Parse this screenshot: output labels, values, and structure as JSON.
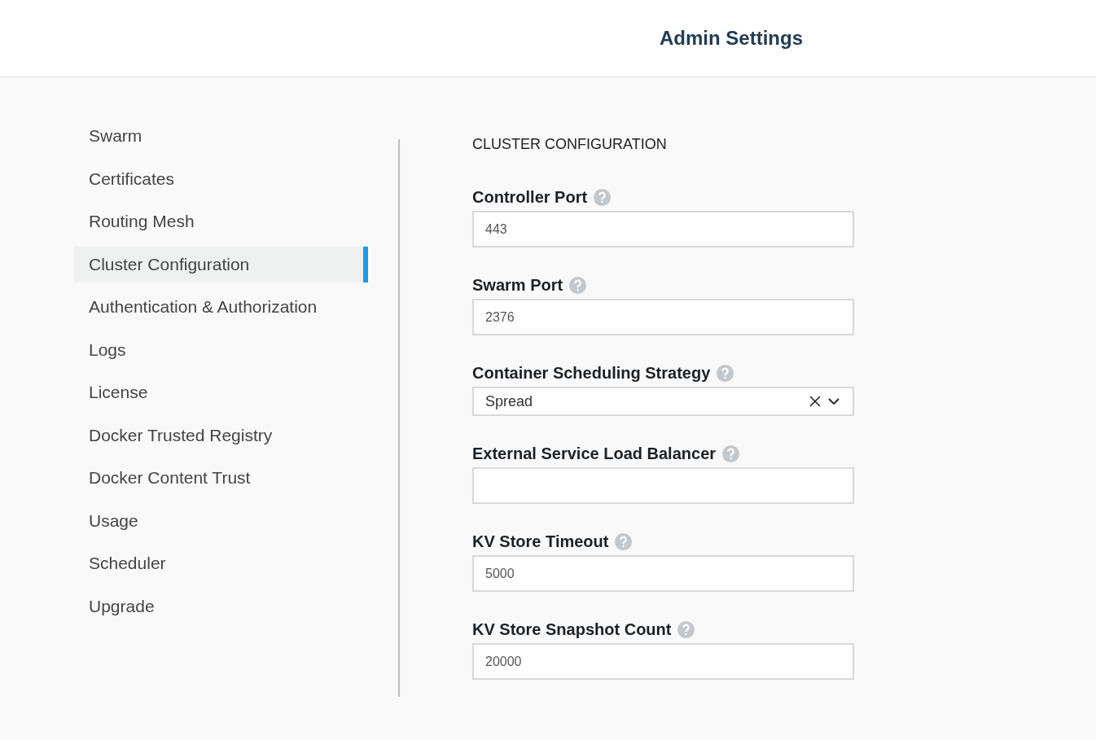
{
  "header": {
    "title": "Admin Settings"
  },
  "sidebar": {
    "items": [
      {
        "label": "Swarm",
        "selected": false
      },
      {
        "label": "Certificates",
        "selected": false
      },
      {
        "label": "Routing Mesh",
        "selected": false
      },
      {
        "label": "Cluster Configuration",
        "selected": true
      },
      {
        "label": "Authentication & Authorization",
        "selected": false
      },
      {
        "label": "Logs",
        "selected": false
      },
      {
        "label": "License",
        "selected": false
      },
      {
        "label": "Docker Trusted Registry",
        "selected": false
      },
      {
        "label": "Docker Content Trust",
        "selected": false
      },
      {
        "label": "Usage",
        "selected": false
      },
      {
        "label": "Scheduler",
        "selected": false
      },
      {
        "label": "Upgrade",
        "selected": false
      }
    ]
  },
  "section": {
    "title": "CLUSTER CONFIGURATION",
    "fields": [
      {
        "kind": "input",
        "label": "Controller Port",
        "value": "443"
      },
      {
        "kind": "input",
        "label": "Swarm Port",
        "value": "2376"
      },
      {
        "kind": "select",
        "label": "Container Scheduling Strategy",
        "value": "Spread"
      },
      {
        "kind": "input",
        "label": "External Service Load Balancer"
      },
      {
        "kind": "input",
        "label": "KV Store Timeout",
        "value": "5000"
      },
      {
        "kind": "input",
        "label": "KV Store Snapshot Count",
        "value": "20000"
      }
    ]
  }
}
